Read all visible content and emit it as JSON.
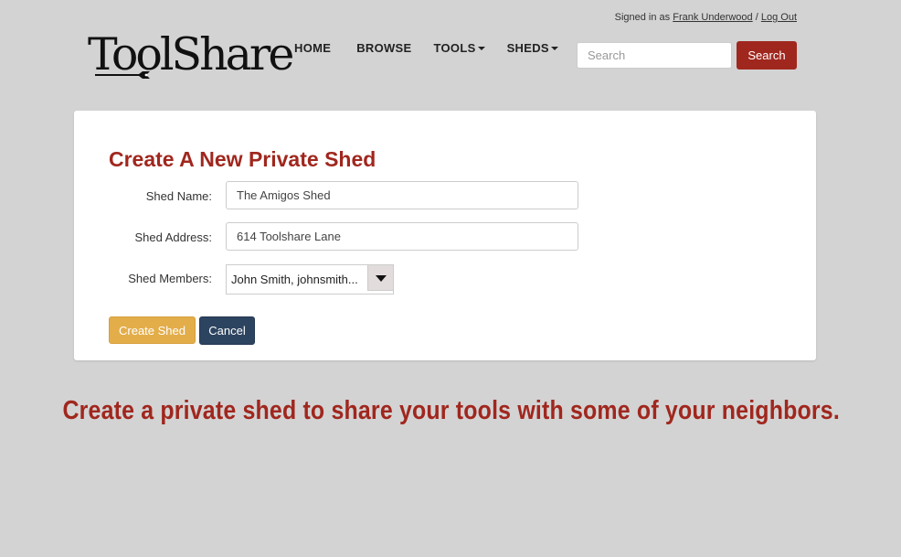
{
  "header": {
    "signed_in_prefix": "Signed in as",
    "user_name": "Frank Underwood",
    "separator": "/",
    "logout_label": "Log Out"
  },
  "logo": {
    "text": "ToolShare"
  },
  "nav": {
    "items": [
      {
        "label": "HOME",
        "dropdown": false
      },
      {
        "label": "BROWSE",
        "dropdown": false
      },
      {
        "label": "TOOLS",
        "dropdown": true
      },
      {
        "label": "SHEDS",
        "dropdown": true
      }
    ]
  },
  "search": {
    "placeholder": "Search",
    "value": "",
    "button_label": "Search"
  },
  "form": {
    "title": "Create A New Private Shed",
    "shed_name_label": "Shed Name:",
    "shed_name_value": "The Amigos Shed",
    "shed_address_label": "Shed Address:",
    "shed_address_value": "614 Toolshare Lane",
    "shed_members_label": "Shed Members:",
    "shed_members_value": "John Smith, johnsmith...",
    "create_button_label": "Create Shed",
    "cancel_button_label": "Cancel"
  },
  "tagline": "Create a private shed to share your tools with some of your neighbors.",
  "colors": {
    "background": "#d3d3d3",
    "brand_red": "#a0271e",
    "create_button": "#e3ad4a",
    "cancel_button": "#2d4460"
  },
  "icons": {
    "logo_mark": "wrench-icon",
    "dropdown_caret": "caret-down-icon",
    "select_arrow": "triangle-down-icon"
  }
}
